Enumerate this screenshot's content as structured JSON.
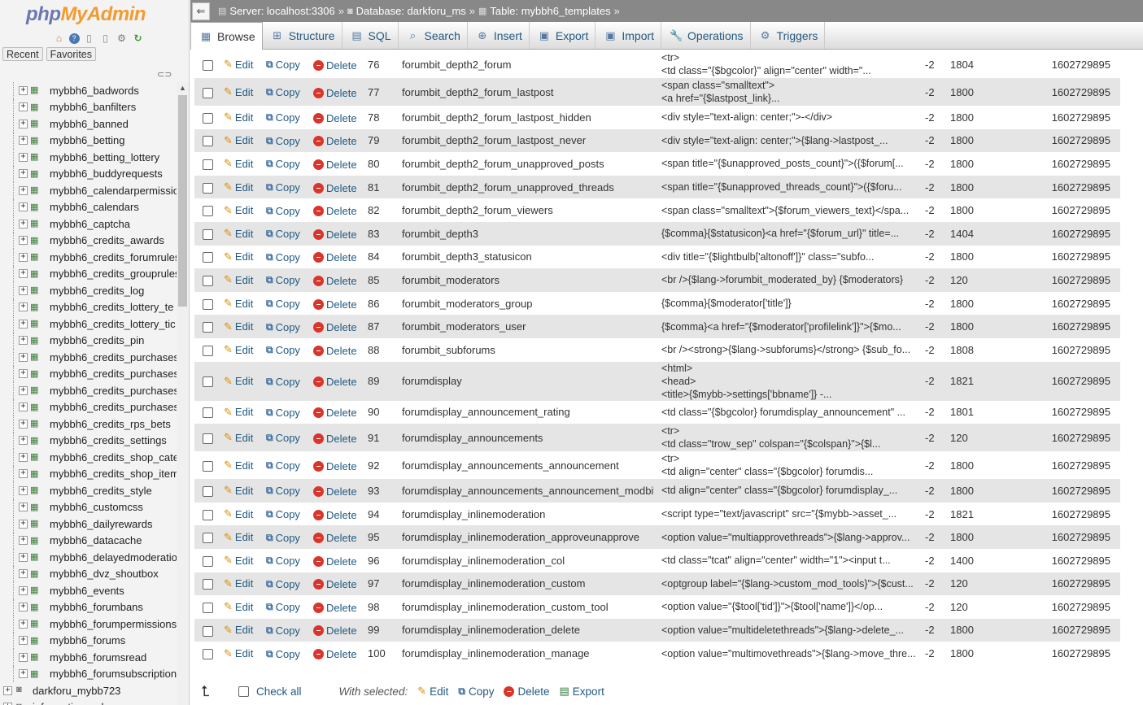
{
  "logo": {
    "part1": "php",
    "part2": "MyAdmin"
  },
  "nav_icons": [
    "home-icon",
    "help-icon",
    "docs-icon",
    "sql-query-icon",
    "settings-icon",
    "reload-icon"
  ],
  "nav_tabs": {
    "recent": "Recent",
    "favorites": "Favorites"
  },
  "tree": {
    "tables": [
      "mybbh6_badwords",
      "mybbh6_banfilters",
      "mybbh6_banned",
      "mybbh6_betting",
      "mybbh6_betting_lottery",
      "mybbh6_buddyrequests",
      "mybbh6_calendarpermissio",
      "mybbh6_calendars",
      "mybbh6_captcha",
      "mybbh6_credits_awards",
      "mybbh6_credits_forumrules",
      "mybbh6_credits_grouprules",
      "mybbh6_credits_log",
      "mybbh6_credits_lottery_te",
      "mybbh6_credits_lottery_tic",
      "mybbh6_credits_pin",
      "mybbh6_credits_purchases",
      "mybbh6_credits_purchases",
      "mybbh6_credits_purchases",
      "mybbh6_credits_purchases",
      "mybbh6_credits_rps_bets",
      "mybbh6_credits_settings",
      "mybbh6_credits_shop_cate",
      "mybbh6_credits_shop_item",
      "mybbh6_credits_style",
      "mybbh6_customcss",
      "mybbh6_dailyrewards",
      "mybbh6_datacache",
      "mybbh6_delayedmoderatio",
      "mybbh6_dvz_shoutbox",
      "mybbh6_events",
      "mybbh6_forumbans",
      "mybbh6_forumpermissions",
      "mybbh6_forums",
      "mybbh6_forumsread",
      "mybbh6_forumsubscription"
    ],
    "databases": [
      "darkforu_mybb723",
      "information_schema"
    ]
  },
  "breadcrumb": {
    "server": "Server: localhost:3306",
    "database": "Database: darkforu_ms",
    "table": "Table: mybbh6_templates",
    "sep": "»"
  },
  "tabs": [
    {
      "label": "Browse",
      "icon": "browse-icon",
      "active": true
    },
    {
      "label": "Structure",
      "icon": "structure-icon"
    },
    {
      "label": "SQL",
      "icon": "sql-icon"
    },
    {
      "label": "Search",
      "icon": "search-icon"
    },
    {
      "label": "Insert",
      "icon": "insert-icon"
    },
    {
      "label": "Export",
      "icon": "export-icon"
    },
    {
      "label": "Import",
      "icon": "import-icon"
    },
    {
      "label": "Operations",
      "icon": "wrench-icon"
    },
    {
      "label": "Triggers",
      "icon": "triggers-icon"
    }
  ],
  "row_actions": {
    "edit": "Edit",
    "copy": "Copy",
    "delete": "Delete"
  },
  "rows": [
    {
      "id": "76",
      "title": "forumbit_depth2_forum",
      "template": [
        "<tr>",
        "<td class=\"{$bgcolor}\" align=\"center\" width=\"..."
      ],
      "sid": "-2",
      "version": "1804",
      "dateline": "1602729895"
    },
    {
      "id": "77",
      "title": "forumbit_depth2_forum_lastpost",
      "template": [
        "<span class=\"smalltext\">",
        "<a href=\"{$lastpost_link}..."
      ],
      "sid": "-2",
      "version": "1800",
      "dateline": "1602729895"
    },
    {
      "id": "78",
      "title": "forumbit_depth2_forum_lastpost_hidden",
      "template": [
        "<div style=\"text-align: center;\">-</div>"
      ],
      "sid": "-2",
      "version": "1800",
      "dateline": "1602729895"
    },
    {
      "id": "79",
      "title": "forumbit_depth2_forum_lastpost_never",
      "template": [
        "<div style=\"text-align: center;\">{$lang->lastpost_..."
      ],
      "sid": "-2",
      "version": "1800",
      "dateline": "1602729895"
    },
    {
      "id": "80",
      "title": "forumbit_depth2_forum_unapproved_posts",
      "template": [
        "<span title=\"{$unapproved_posts_count}\">({$forum[..."
      ],
      "sid": "-2",
      "version": "1800",
      "dateline": "1602729895"
    },
    {
      "id": "81",
      "title": "forumbit_depth2_forum_unapproved_threads",
      "template": [
        "<span title=\"{$unapproved_threads_count}\">({$foru..."
      ],
      "sid": "-2",
      "version": "1800",
      "dateline": "1602729895"
    },
    {
      "id": "82",
      "title": "forumbit_depth2_forum_viewers",
      "template": [
        "<span class=\"smalltext\">{$forum_viewers_text}</spa..."
      ],
      "sid": "-2",
      "version": "1800",
      "dateline": "1602729895"
    },
    {
      "id": "83",
      "title": "forumbit_depth3",
      "template": [
        "{$comma}{$statusicon}<a href=\"{$forum_url}\" title=..."
      ],
      "sid": "-2",
      "version": "1404",
      "dateline": "1602729895"
    },
    {
      "id": "84",
      "title": "forumbit_depth3_statusicon",
      "template": [
        "<div title=\"{$lightbulb['altonoff']}\" class=\"subfo..."
      ],
      "sid": "-2",
      "version": "1800",
      "dateline": "1602729895"
    },
    {
      "id": "85",
      "title": "forumbit_moderators",
      "template": [
        "<br />{$lang->forumbit_moderated_by} {$moderators}"
      ],
      "sid": "-2",
      "version": "120",
      "dateline": "1602729895"
    },
    {
      "id": "86",
      "title": "forumbit_moderators_group",
      "template": [
        "{$comma}{$moderator['title']}"
      ],
      "sid": "-2",
      "version": "1800",
      "dateline": "1602729895"
    },
    {
      "id": "87",
      "title": "forumbit_moderators_user",
      "template": [
        "{$comma}<a href=\"{$moderator['profilelink']}\">{$mo..."
      ],
      "sid": "-2",
      "version": "1800",
      "dateline": "1602729895"
    },
    {
      "id": "88",
      "title": "forumbit_subforums",
      "template": [
        "<br /><strong>{$lang->subforums}</strong> {$sub_fo..."
      ],
      "sid": "-2",
      "version": "1808",
      "dateline": "1602729895"
    },
    {
      "id": "89",
      "title": "forumdisplay",
      "template": [
        "<html>",
        "<head>",
        "<title>{$mybb->settings['bbname']} -..."
      ],
      "sid": "-2",
      "version": "1821",
      "dateline": "1602729895"
    },
    {
      "id": "90",
      "title": "forumdisplay_announcement_rating",
      "template": [
        "<td class=\"{$bgcolor} forumdisplay_announcement\" ..."
      ],
      "sid": "-2",
      "version": "1801",
      "dateline": "1602729895"
    },
    {
      "id": "91",
      "title": "forumdisplay_announcements",
      "template": [
        "<tr>",
        "<td class=\"trow_sep\" colspan=\"{$colspan}\">{$l..."
      ],
      "sid": "-2",
      "version": "120",
      "dateline": "1602729895"
    },
    {
      "id": "92",
      "title": "forumdisplay_announcements_announcement",
      "template": [
        "<tr>",
        "<td align=\"center\" class=\"{$bgcolor} forumdis..."
      ],
      "sid": "-2",
      "version": "1800",
      "dateline": "1602729895"
    },
    {
      "id": "93",
      "title": "forumdisplay_announcements_announcement_modbit",
      "template": [
        "<td align=\"center\" class=\"{$bgcolor} forumdisplay_..."
      ],
      "sid": "-2",
      "version": "1800",
      "dateline": "1602729895"
    },
    {
      "id": "94",
      "title": "forumdisplay_inlinemoderation",
      "template": [
        "<script type=\"text/javascript\" src=\"{$mybb->asset_..."
      ],
      "sid": "-2",
      "version": "1821",
      "dateline": "1602729895"
    },
    {
      "id": "95",
      "title": "forumdisplay_inlinemoderation_approveunapprove",
      "template": [
        "<option value=\"multiapprovethreads\">{$lang->approv..."
      ],
      "sid": "-2",
      "version": "1800",
      "dateline": "1602729895"
    },
    {
      "id": "96",
      "title": "forumdisplay_inlinemoderation_col",
      "template": [
        "<td class=\"tcat\" align=\"center\" width=\"1\"><input t..."
      ],
      "sid": "-2",
      "version": "1400",
      "dateline": "1602729895"
    },
    {
      "id": "97",
      "title": "forumdisplay_inlinemoderation_custom",
      "template": [
        "<optgroup label=\"{$lang->custom_mod_tools}\">{$cust..."
      ],
      "sid": "-2",
      "version": "120",
      "dateline": "1602729895"
    },
    {
      "id": "98",
      "title": "forumdisplay_inlinemoderation_custom_tool",
      "template": [
        "<option value=\"{$tool['tid']}\">{$tool['name']}</op..."
      ],
      "sid": "-2",
      "version": "120",
      "dateline": "1602729895"
    },
    {
      "id": "99",
      "title": "forumdisplay_inlinemoderation_delete",
      "template": [
        "<option value=\"multideletethreads\">{$lang->delete_..."
      ],
      "sid": "-2",
      "version": "1800",
      "dateline": "1602729895"
    },
    {
      "id": "100",
      "title": "forumdisplay_inlinemoderation_manage",
      "template": [
        "<option value=\"multimovethreads\">{$lang->move_thre..."
      ],
      "sid": "-2",
      "version": "1800",
      "dateline": "1602729895"
    }
  ],
  "bottom": {
    "check_all": "Check all",
    "with_selected": "With selected:",
    "edit": "Edit",
    "copy": "Copy",
    "delete": "Delete",
    "export": "Export"
  }
}
